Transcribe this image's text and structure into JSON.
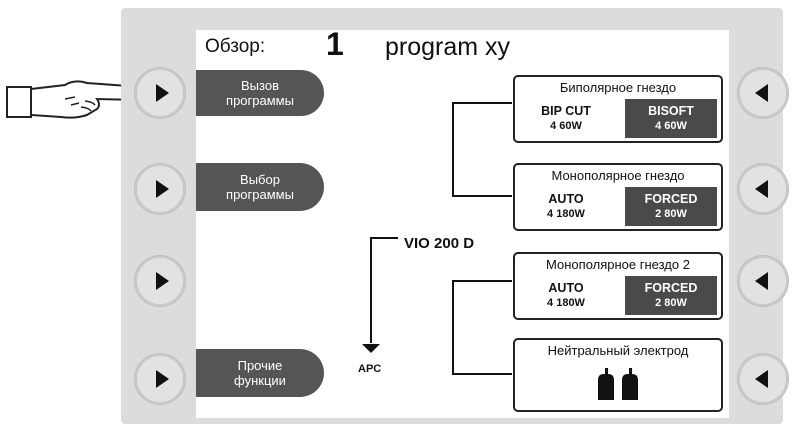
{
  "header": {
    "label": "Обзор:",
    "program_number": "1",
    "program_name": "program xy"
  },
  "softkeys": [
    {
      "line1": "Вызов",
      "line2": "программы"
    },
    {
      "line1": "Выбор",
      "line2": "программы"
    },
    {
      "line1": "Прочие",
      "line2": "функции"
    }
  ],
  "device_name": "VIO 200 D",
  "apc_label": "APC",
  "sockets": [
    {
      "title": "Биполярное гнездо",
      "left_mode": "BIP CUT",
      "left_value": "4   60W",
      "right_mode": "BISOFT",
      "right_value": "4   60W"
    },
    {
      "title": "Монополярное гнездо",
      "left_mode": "AUTO",
      "left_value": "4   180W",
      "right_mode": "FORCED",
      "right_value": "2   80W"
    },
    {
      "title": "Монополярное гнездо 2",
      "left_mode": "AUTO",
      "left_value": "4   180W",
      "right_mode": "FORCED",
      "right_value": "2   80W"
    }
  ],
  "neutral_electrode": {
    "title": "Нейтральный электрод",
    "icon": "neutral-electrode-icon"
  },
  "pointer_icon": "pointing-hand-icon"
}
